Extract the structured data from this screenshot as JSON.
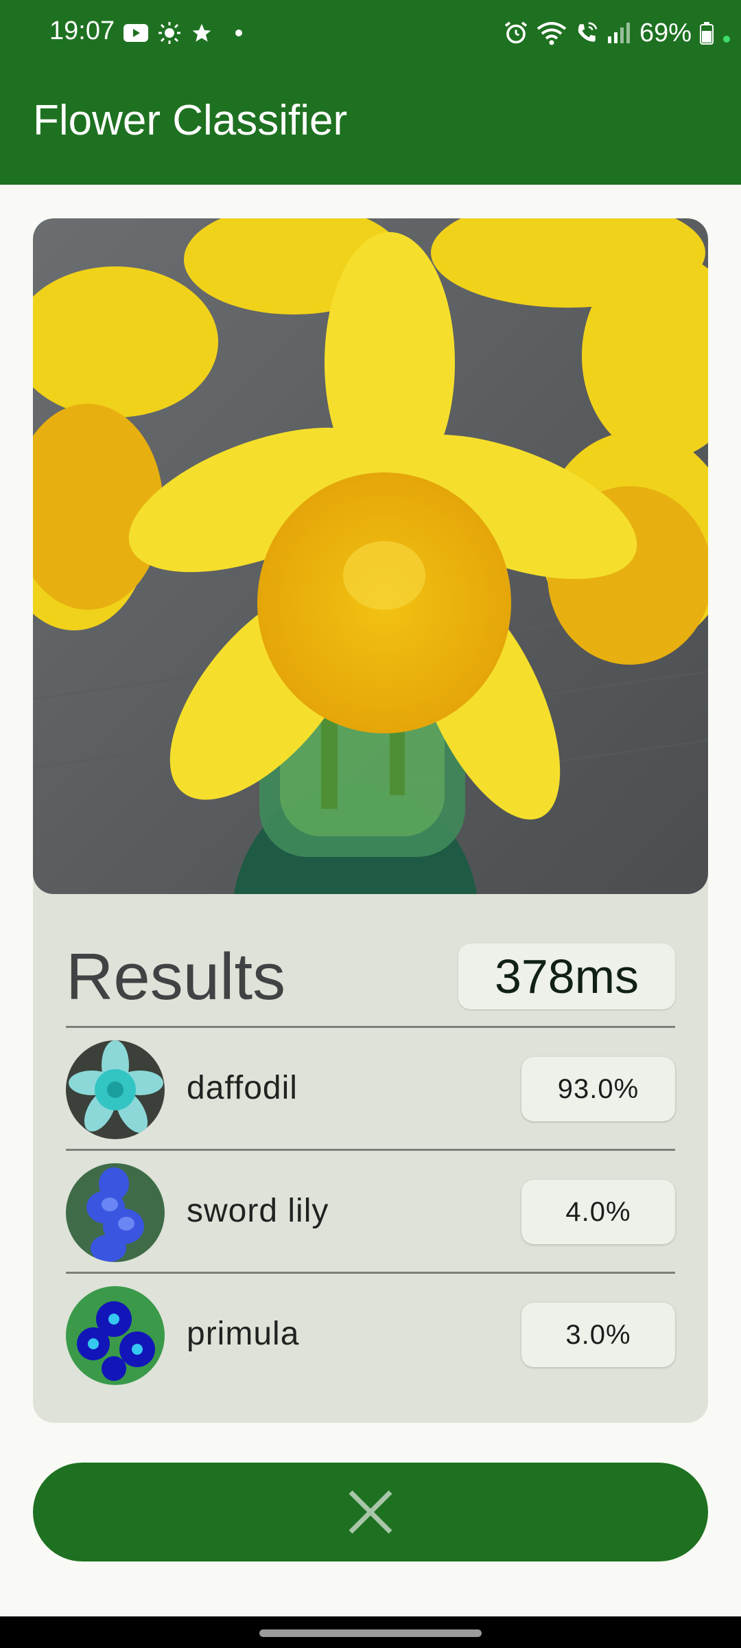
{
  "status_bar": {
    "time": "19:07",
    "battery": "69%",
    "left_icons": [
      "youtube-icon",
      "brightness-icon",
      "star-icon",
      "dot-icon"
    ],
    "right_icons": [
      "alarm-icon",
      "wifi-icon",
      "wifi-call-icon",
      "signal-icon",
      "battery-icon",
      "charging-dot-icon"
    ]
  },
  "app_bar": {
    "title": "Flower Classifier"
  },
  "results": {
    "title": "Results",
    "inference_time": "378ms",
    "items": [
      {
        "label": "daffodil",
        "score": "93.0%",
        "thumb_color": "#33c4c4"
      },
      {
        "label": "sword lily",
        "score": "4.0%",
        "thumb_color": "#3a55e0"
      },
      {
        "label": "primula",
        "score": "3.0%",
        "thumb_color": "#1216b8"
      }
    ]
  },
  "fab": {
    "icon": "close-icon"
  },
  "colors": {
    "primary": "#1e7121",
    "card": "#dee2d8",
    "chip": "#eef1ea",
    "background": "#f9faf5"
  }
}
